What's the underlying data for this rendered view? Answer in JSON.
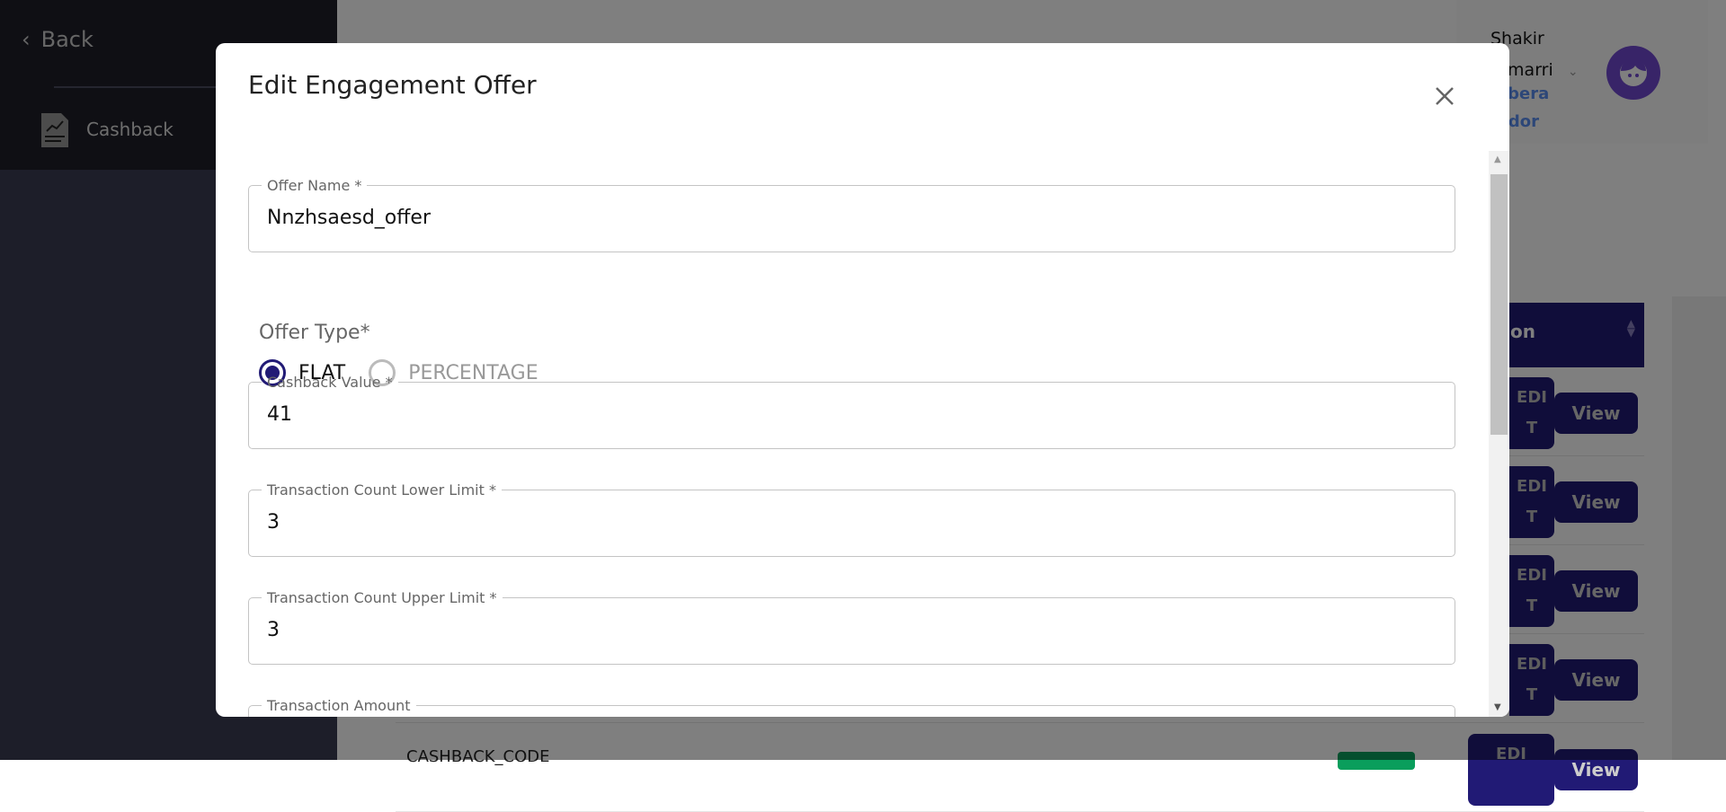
{
  "sidebar": {
    "back_label": "Back",
    "items": [
      {
        "label": "Cashback",
        "icon": "report-chart-icon"
      }
    ]
  },
  "header": {
    "user_line1": "Shakir",
    "user_line2": "umarri",
    "org": "abera",
    "role": "ndor",
    "avatar_icon": "user-face-icon"
  },
  "table": {
    "header_fragment": "on",
    "rows": [
      {
        "edit": "EDIT",
        "view": "View"
      },
      {
        "edit": "EDIT",
        "view": "View"
      },
      {
        "edit": "EDIT",
        "view": "View"
      },
      {
        "edit": "EDIT",
        "view": "View"
      },
      {
        "edit": "EDI",
        "view": "View"
      }
    ],
    "last_row_code": "CASHBACK_CODE"
  },
  "modal": {
    "title": "Edit Engagement Offer",
    "fields": {
      "offer_name": {
        "label": "Offer Name *",
        "value": "Nnzhsaesd_offer"
      },
      "offer_type": {
        "label": "Offer Type*",
        "options": [
          "FLAT",
          "PERCENTAGE"
        ],
        "selected": "FLAT"
      },
      "cashback_value": {
        "label": "Cashback Value *",
        "value": "41"
      },
      "txn_lower": {
        "label": "Transaction Count Lower Limit *",
        "value": "3"
      },
      "txn_upper": {
        "label": "Transaction Count Upper Limit  *",
        "value": "3"
      },
      "txn_amount": {
        "label": "Transaction Amount"
      }
    }
  },
  "colors": {
    "primary": "#211a75",
    "sidebar": "#1e1e28",
    "link": "#5b8ef0",
    "avatar": "#7048d0"
  }
}
